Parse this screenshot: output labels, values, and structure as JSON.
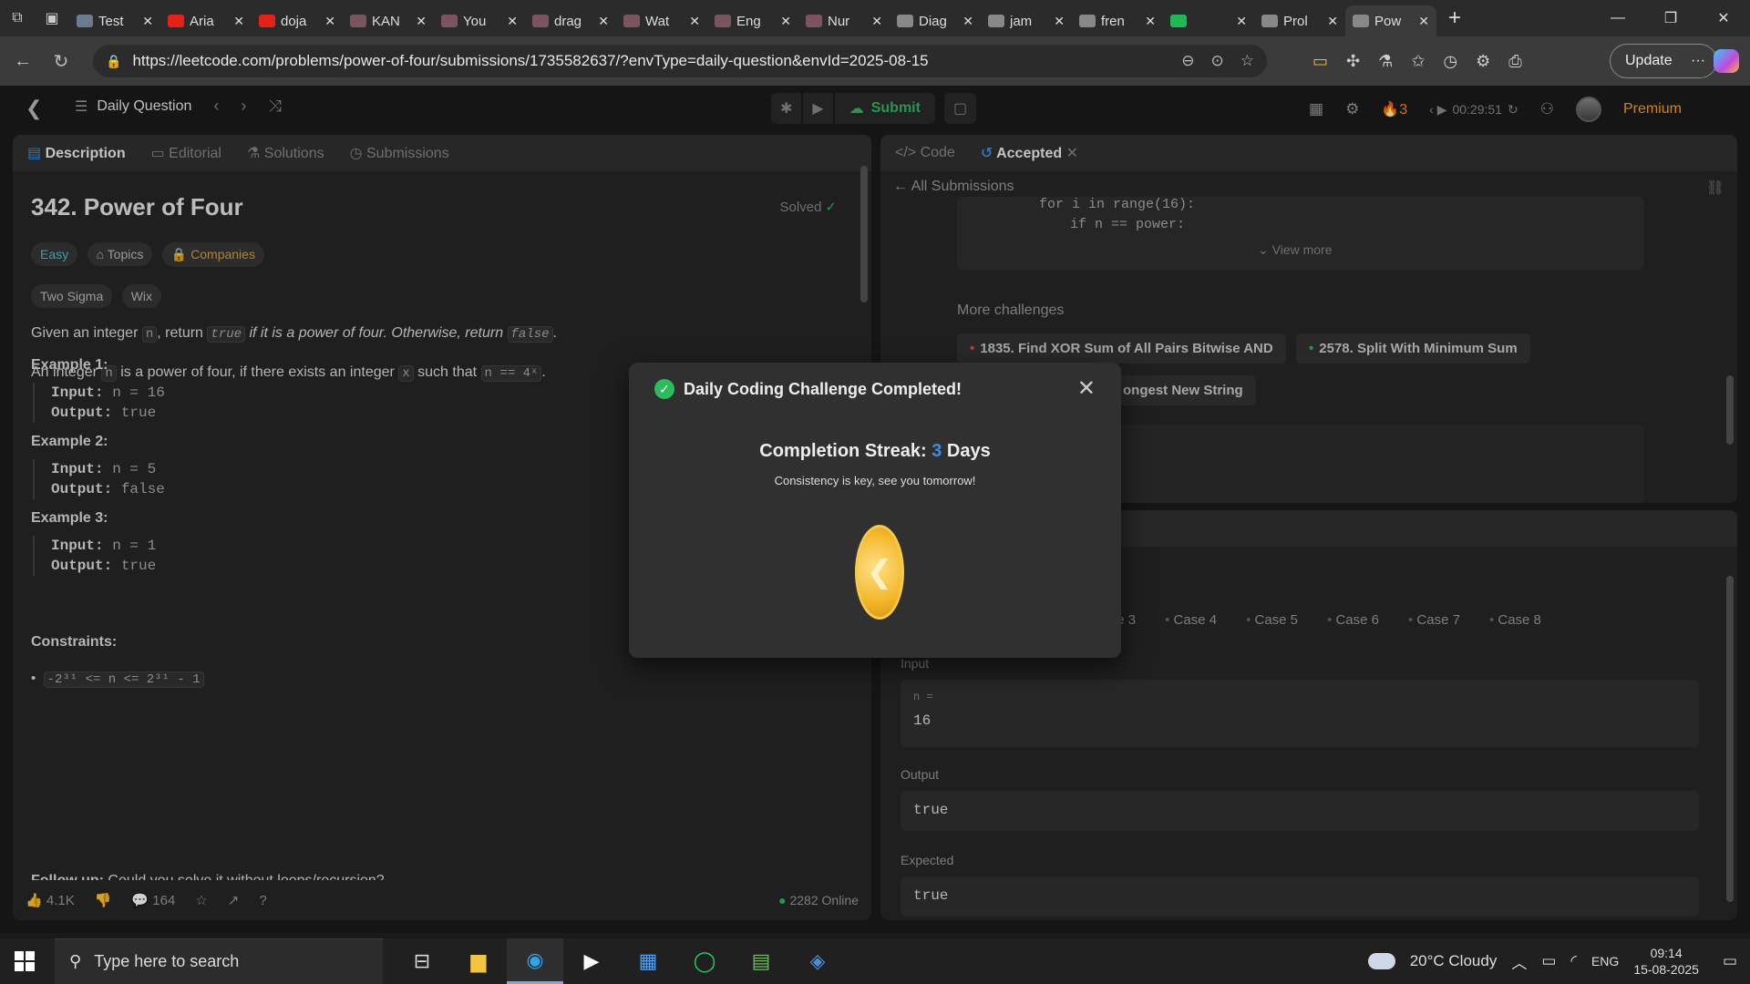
{
  "browser": {
    "tabs": [
      {
        "label": "Test",
        "color": "#6d7b8f"
      },
      {
        "label": "Aria",
        "color": "#e62117"
      },
      {
        "label": "doja",
        "color": "#e62117"
      },
      {
        "label": "KAN",
        "color": "#7a5560"
      },
      {
        "label": "You",
        "color": "#7a5560"
      },
      {
        "label": "drag",
        "color": "#7a5560"
      },
      {
        "label": "Wat",
        "color": "#7a5560"
      },
      {
        "label": "Eng",
        "color": "#7a5560"
      },
      {
        "label": "Nur",
        "color": "#7a5560"
      },
      {
        "label": "Diag",
        "color": "#888888"
      },
      {
        "label": "jam",
        "color": "#888888"
      },
      {
        "label": "fren",
        "color": "#888888"
      },
      {
        "label": "",
        "color": "#1db954"
      },
      {
        "label": "Prol",
        "color": "#888888"
      },
      {
        "label": "Pow",
        "color": "#888888",
        "active": true
      }
    ],
    "url": "https://leetcode.com/problems/power-of-four/submissions/1735582637/?envType=daily-question&envId=2025-08-15",
    "update_label": "Update"
  },
  "nav": {
    "daily_question": "Daily Question",
    "submit": "Submit",
    "streak": "3",
    "timer": "00:29:51",
    "premium": "Premium"
  },
  "left": {
    "tabs": [
      "Description",
      "Editorial",
      "Solutions",
      "Submissions"
    ],
    "title": "342. Power of Four",
    "solved": "Solved",
    "difficulty": "Easy",
    "topics": "Topics",
    "companies": "Companies",
    "company_tags": [
      "Two Sigma",
      "Wix"
    ],
    "desc1_a": "Given an integer ",
    "desc1_n": "n",
    "desc1_b": ", return ",
    "desc1_true": "true",
    "desc1_c": " if it is a power of four. Otherwise, return ",
    "desc1_false": "false",
    "desc1_d": ".",
    "desc2_a": "An integer ",
    "desc2_n": "n",
    "desc2_b": " is a power of four, if there exists an integer ",
    "desc2_x": "x",
    "desc2_c": " such that ",
    "desc2_eq": "n == 4ˣ",
    "desc2_d": ".",
    "examples": [
      {
        "heading": "Example 1:",
        "input": "n = 16",
        "output": "true"
      },
      {
        "heading": "Example 2:",
        "input": "n = 5",
        "output": "false"
      },
      {
        "heading": "Example 3:",
        "input": "n = 1",
        "output": "true"
      }
    ],
    "input_label": "Input:",
    "output_label": "Output:",
    "constraints_heading": "Constraints:",
    "constraint": "-2³¹ <= n <= 2³¹ - 1",
    "followup_bold": "Follow up:",
    "followup_text": " Could you solve it without loops/recursion?",
    "likes": "4.1K",
    "comments": "164",
    "online": "2282 Online"
  },
  "right": {
    "code_tab": "Code",
    "accepted_tab": "Accepted",
    "all_submissions": "All Submissions",
    "code_line1": "for i in range(16):",
    "code_line2": "if n == power:",
    "view_more": "View more",
    "more_challenges": "More challenges",
    "challenges": [
      {
        "label": "1835. Find XOR Sum of All Pairs Bitwise AND",
        "color": "#ef4743"
      },
      {
        "label": "2578. Split With Minimum Sum",
        "color": "#2cbb5d"
      },
      {
        "label": "ongest New String",
        "color": "#ffb800"
      }
    ],
    "cases": [
      "ase 3",
      "Case 4",
      "Case 5",
      "Case 6",
      "Case 7",
      "Case 8"
    ],
    "input_label": "Input",
    "input_var": "n =",
    "input_val": "16",
    "output_label": "Output",
    "output_val": "true",
    "expected_label": "Expected",
    "expected_val": "true"
  },
  "modal": {
    "title": "Daily Coding Challenge Completed!",
    "streak_prefix": "Completion Streak: ",
    "streak_num": "3",
    "streak_suffix": " Days",
    "subtitle": "Consistency is key, see you tomorrow!"
  },
  "taskbar": {
    "search_placeholder": "Type here to search",
    "weather": "20°C  Cloudy",
    "lang": "ENG",
    "time": "09:14",
    "date": "15-08-2025"
  }
}
